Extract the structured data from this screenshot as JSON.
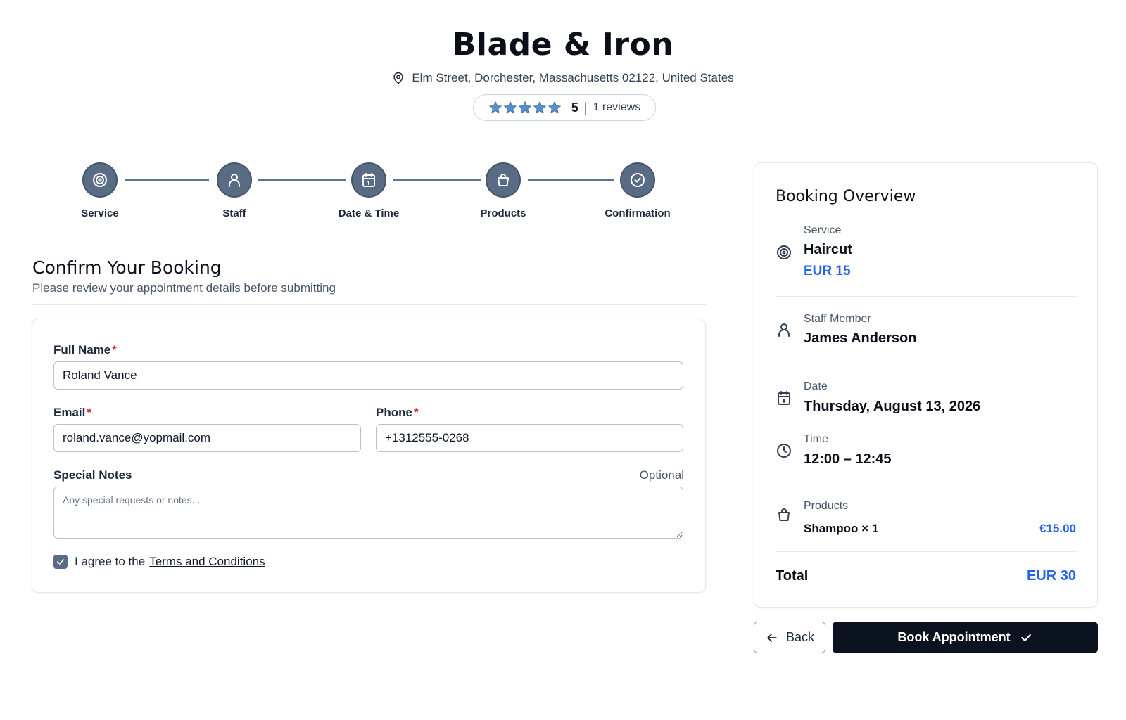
{
  "shop": {
    "name": "Blade & Iron",
    "address": "Elm Street, Dorchester, Massachusetts 02122, United States",
    "rating": "5",
    "rating_sep": "|",
    "reviews": "1 reviews",
    "stars_count": 5
  },
  "stepper": {
    "steps": [
      {
        "label": "Service",
        "icon": "target-icon"
      },
      {
        "label": "Staff",
        "icon": "user-icon"
      },
      {
        "label": "Date & Time",
        "icon": "calendar-icon"
      },
      {
        "label": "Products",
        "icon": "shopping-bag-icon"
      },
      {
        "label": "Confirmation",
        "icon": "check-circle-icon"
      }
    ]
  },
  "confirm": {
    "title": "Confirm Your Booking",
    "subtitle": "Please review your appointment details before submitting"
  },
  "form": {
    "full_name_label": "Full Name",
    "full_name_value": "Roland Vance",
    "email_label": "Email",
    "email_value": "roland.vance@yopmail.com",
    "phone_label": "Phone",
    "phone_value": "+1312555-0268",
    "required_mark": "*",
    "notes_label": "Special Notes",
    "notes_optional": "Optional",
    "notes_placeholder": "Any special requests or notes...",
    "agree_prefix": "I agree to the",
    "agree_link": "Terms and Conditions",
    "agree_checked": true
  },
  "overview": {
    "title": "Booking Overview",
    "service_label": "Service",
    "service_value": "Haircut",
    "service_price": "EUR 15",
    "staff_label": "Staff Member",
    "staff_value": "James Anderson",
    "date_label": "Date",
    "date_value": "Thursday, August 13, 2026",
    "time_label": "Time",
    "time_value": "12:00 – 12:45",
    "products_label": "Products",
    "product_name": "Shampoo × 1",
    "product_price": "€15.00",
    "total_label": "Total",
    "total_value": "EUR 30"
  },
  "actions": {
    "back_label": "Back",
    "book_label": "Book Appointment"
  },
  "colors": {
    "accent_blue": "#2563eb",
    "step_circle": "#5a6b86",
    "star": "#5b8fc7",
    "primary_button": "#0b1220",
    "required": "#dc2626"
  }
}
